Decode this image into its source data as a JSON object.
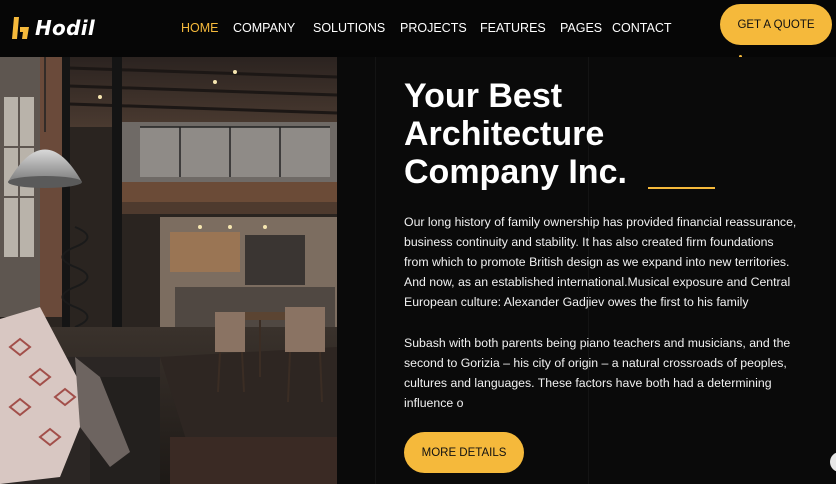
{
  "brand": {
    "name": "Hodil",
    "accent_color": "#f5b93b",
    "logo_icon": "h-logo-icon"
  },
  "nav": {
    "items": [
      {
        "label": "HOME",
        "active": true
      },
      {
        "label": "COMPANY",
        "active": false
      },
      {
        "label": "SOLUTIONS",
        "active": false
      },
      {
        "label": "PROJECTS",
        "active": false
      },
      {
        "label": "FEATURES",
        "active": false
      },
      {
        "label": "PAGES",
        "active": false
      },
      {
        "label": "CONTACT",
        "active": false
      }
    ],
    "cta_label": "GET A QUOTE"
  },
  "hero": {
    "image": "loft-interior-photo",
    "title_lines": [
      "Your Best",
      "Architecture",
      "Company Inc."
    ],
    "paragraph_1": "Our long history of family ownership has provided financial reassurance, business continuity and stability. It has also created firm foundations from which to promote British design as we expand into new territories. And now, as an established international.Musical exposure and Central European culture: Alexander Gadjiev owes the first to his family",
    "paragraph_2": "Subash with both parents being piano teachers and musicians, and the second to Gorizia – his city of origin – a natural crossroads of peoples, cultures and languages. These factors have both had a determining influence o",
    "button_label": "MORE DETAILS"
  }
}
